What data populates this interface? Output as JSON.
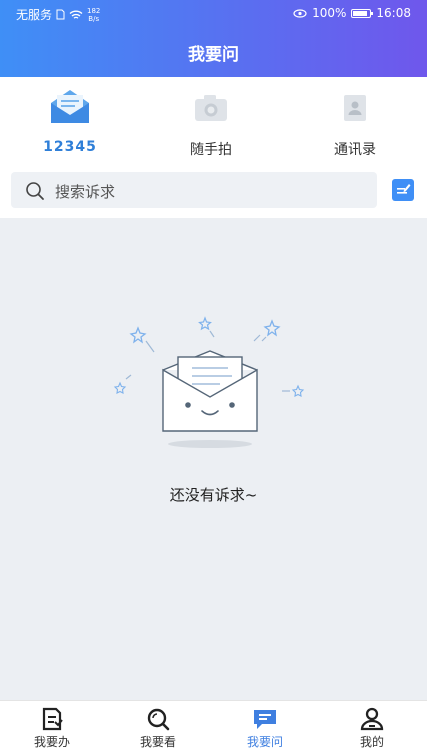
{
  "status_bar": {
    "carrier": "无服务",
    "speed_value": "182",
    "speed_unit": "B/s",
    "battery": "100%",
    "time": "16:08"
  },
  "header": {
    "title": "我要问"
  },
  "quick_actions": [
    {
      "label": "12345",
      "icon": "mail-icon"
    },
    {
      "label": "随手拍",
      "icon": "camera-icon"
    },
    {
      "label": "通讯录",
      "icon": "contacts-icon"
    }
  ],
  "search": {
    "placeholder": "搜索诉求"
  },
  "empty_state": {
    "message": "还没有诉求~"
  },
  "tab_bar": [
    {
      "label": "我要办",
      "icon": "document-icon"
    },
    {
      "label": "我要看",
      "icon": "search-icon"
    },
    {
      "label": "我要问",
      "icon": "chat-icon",
      "active": true
    },
    {
      "label": "我的",
      "icon": "person-icon"
    }
  ],
  "colors": {
    "accent": "#3f8ff6",
    "header_end": "#6f57ec",
    "active_tab": "#3f7fe0"
  }
}
